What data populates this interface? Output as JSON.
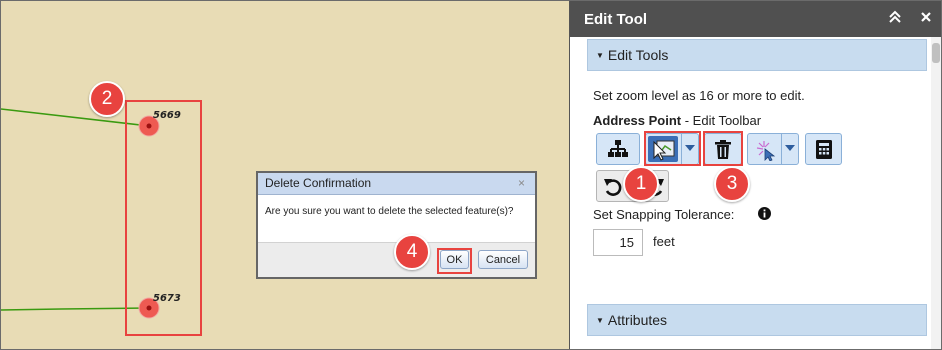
{
  "map": {
    "labels": [
      "5669",
      "5673"
    ]
  },
  "callouts": [
    "1",
    "2",
    "3",
    "4"
  ],
  "dialog": {
    "title": "Delete Confirmation",
    "close_glyph": "×",
    "message": "Are you sure you want to delete the selected feature(s)?",
    "ok_label": "OK",
    "cancel_label": "Cancel"
  },
  "panel": {
    "title": "Edit Tool",
    "collapse_icon": "double-chevron-up-icon",
    "close_icon": "close-icon",
    "edit_tools_label": "Edit Tools",
    "zoom_notice": "Set zoom level as 16 or more to edit.",
    "layer_name": "Address Point",
    "toolbar_suffix": " - Edit Toolbar",
    "snapping_label": "Set Snapping Tolerance:",
    "snapping_value": "15",
    "snapping_unit": "feet",
    "attributes_label": "Attributes"
  },
  "colors": {
    "accent": "#e8433f",
    "map_bg": "#e8dcb5",
    "line": "#3a9a10",
    "header": "#505050",
    "section": "#c8dcef"
  }
}
